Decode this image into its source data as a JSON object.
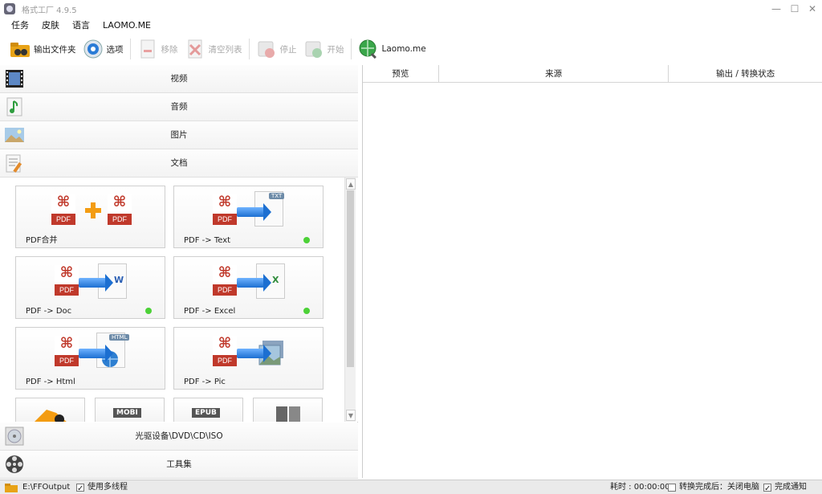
{
  "window": {
    "title": "格式工厂 4.9.5",
    "controls": [
      "—",
      "☐",
      "✕"
    ]
  },
  "menu": [
    "任务",
    "皮肤",
    "语言",
    "LAOMO.ME"
  ],
  "toolbar": {
    "output_folder": "输出文件夹",
    "options": "选项",
    "remove": "移除",
    "clear_list": "清空列表",
    "stop": "停止",
    "start": "开始",
    "laomo": "Laomo.me"
  },
  "categories": {
    "video": "视频",
    "audio": "音频",
    "image": "图片",
    "document": "文档",
    "disc": "光驱设备\\DVD\\CD\\ISO",
    "tools": "工具集"
  },
  "doc_tiles": [
    {
      "label": "PDF合并",
      "ready": false
    },
    {
      "label": "PDF -> Text",
      "ready": true
    },
    {
      "label": "PDF -> Doc",
      "ready": true
    },
    {
      "label": "PDF -> Excel",
      "ready": true
    },
    {
      "label": "PDF -> Html",
      "ready": false
    },
    {
      "label": "PDF -> Pic",
      "ready": false
    }
  ],
  "tile_badges": {
    "pdf": "PDF",
    "txt": "TXT",
    "word": "W",
    "excel": "X",
    "html": "HTML",
    "mobi": "MOBI",
    "epub": "EPUB"
  },
  "table": {
    "columns": [
      "预览",
      "来源",
      "输出 / 转换状态"
    ]
  },
  "status": {
    "output_path": "E:\\FFOutput",
    "multithread": "使用多线程",
    "elapsed": "耗时 : 00:00:00",
    "shutdown": "转换完成后：关闭电脑",
    "notify": "完成通知"
  },
  "colors": {
    "ready_dot": "#4cd137",
    "pdf_red": "#c0392b"
  }
}
